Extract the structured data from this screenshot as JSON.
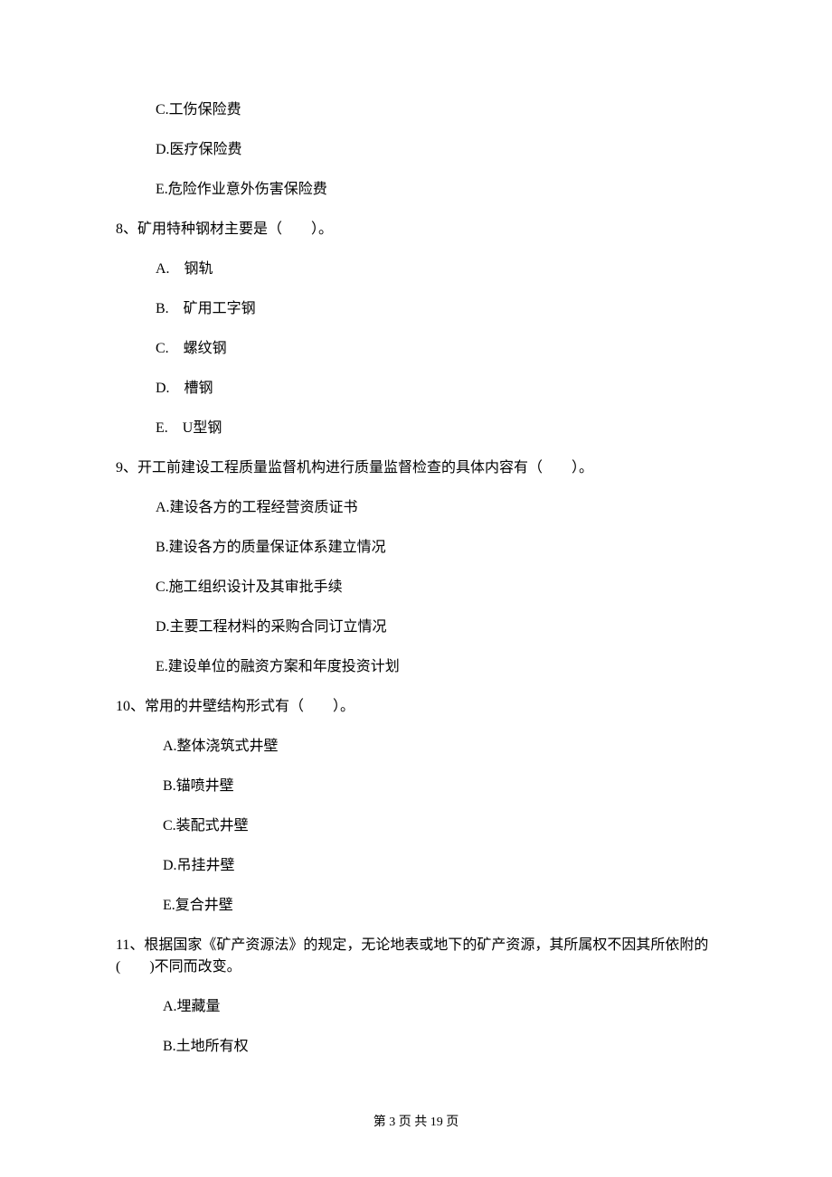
{
  "q7_options": {
    "c": "C.工伤保险费",
    "d": "D.医疗保险费",
    "e": "E.危险作业意外伤害保险费"
  },
  "q8": {
    "stem": "8、矿用特种钢材主要是（　　）。",
    "a": "A.　钢轨",
    "b": "B.　矿用工字钢",
    "c": "C.　螺纹钢",
    "d": "D.　槽钢",
    "e": "E.　U型钢"
  },
  "q9": {
    "stem": "9、开工前建设工程质量监督机构进行质量监督检查的具体内容有（　　）。",
    "a": "A.建设各方的工程经营资质证书",
    "b": "B.建设各方的质量保证体系建立情况",
    "c": "C.施工组织设计及其审批手续",
    "d": "D.主要工程材料的采购合同订立情况",
    "e": "E.建设单位的融资方案和年度投资计划"
  },
  "q10": {
    "stem": "10、常用的井壁结构形式有（　　）。",
    "a": "A.整体浇筑式井壁",
    "b": "B.锚喷井壁",
    "c": "C.装配式井壁",
    "d": "D.吊挂井壁",
    "e": "E.复合井壁"
  },
  "q11": {
    "stem": "11、根据国家《矿产资源法》的规定，无论地表或地下的矿产资源，其所属权不因其所依附的(　　)不同而改变。",
    "a": "A.埋藏量",
    "b": "B.土地所有权"
  },
  "footer": "第 3 页 共 19 页"
}
